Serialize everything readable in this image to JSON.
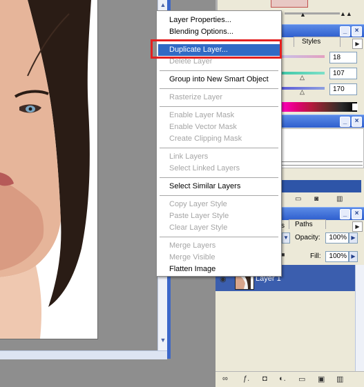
{
  "context_menu": {
    "items": [
      {
        "label": "Layer Properties...",
        "enabled": true,
        "highlighted": false
      },
      {
        "label": "Blending Options...",
        "enabled": true,
        "highlighted": false
      },
      {
        "label": "Duplicate Layer...",
        "enabled": true,
        "highlighted": true
      },
      {
        "label": "Delete Layer",
        "enabled": false,
        "highlighted": false
      },
      {
        "label": "Group into New Smart Object",
        "enabled": true,
        "highlighted": false
      },
      {
        "label": "Rasterize Layer",
        "enabled": false,
        "highlighted": false
      },
      {
        "label": "Enable Layer Mask",
        "enabled": false,
        "highlighted": false
      },
      {
        "label": "Enable Vector Mask",
        "enabled": false,
        "highlighted": false
      },
      {
        "label": "Create Clipping Mask",
        "enabled": false,
        "highlighted": false
      },
      {
        "label": "Link Layers",
        "enabled": false,
        "highlighted": false
      },
      {
        "label": "Select Linked Layers",
        "enabled": false,
        "highlighted": false
      },
      {
        "label": "Select Similar Layers",
        "enabled": true,
        "highlighted": false
      },
      {
        "label": "Copy Layer Style",
        "enabled": false,
        "highlighted": false
      },
      {
        "label": "Paste Layer Style",
        "enabled": false,
        "highlighted": false
      },
      {
        "label": "Clear Layer Style",
        "enabled": false,
        "highlighted": false
      },
      {
        "label": "Merge Layers",
        "enabled": false,
        "highlighted": false
      },
      {
        "label": "Merge Visible",
        "enabled": false,
        "highlighted": false
      },
      {
        "label": "Flatten Image",
        "enabled": true,
        "highlighted": false
      }
    ]
  },
  "color_palette": {
    "tab_styles": "Styles",
    "values": [
      "18",
      "107",
      "170"
    ]
  },
  "layers_palette": {
    "tab_partial": "s",
    "tab_paths": "Paths",
    "opacity_label": "Opacity:",
    "opacity_value": "100%",
    "fill_label": "Fill:",
    "fill_value": "100%",
    "layer_name": "Layer 1"
  },
  "icons": {
    "minimize": "_",
    "close": "×",
    "menu_arrow": "▶",
    "right_arrow": "▶",
    "down_arrow": "▼",
    "eye": "◉",
    "lock": "🔒"
  }
}
